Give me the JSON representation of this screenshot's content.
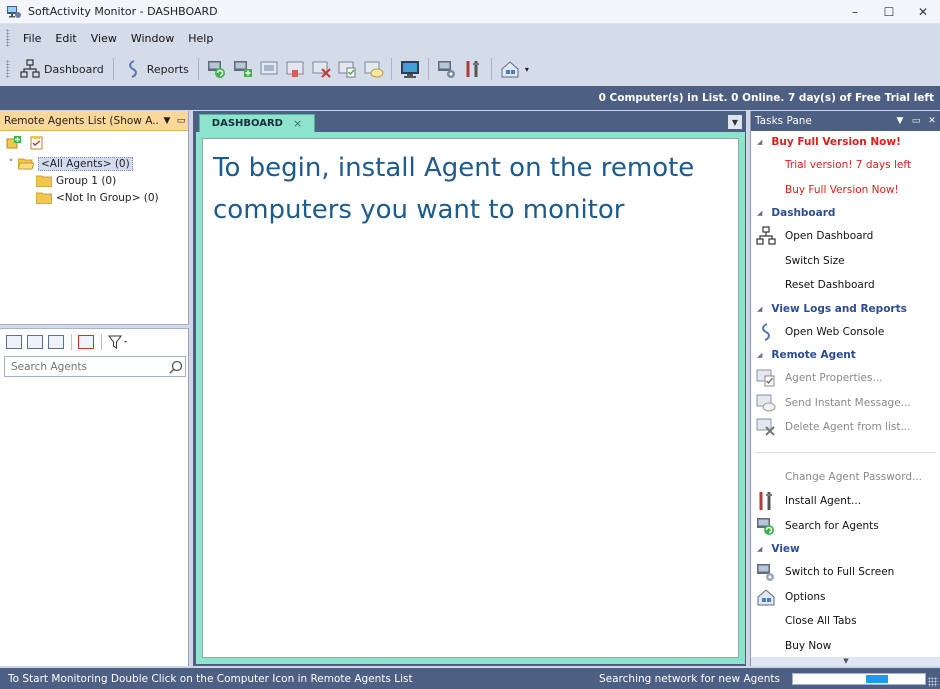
{
  "window": {
    "title": "SoftActivity Monitor - DASHBOARD",
    "controls": [
      "–",
      "☐",
      "✕"
    ]
  },
  "menu": [
    "File",
    "Edit",
    "View",
    "Window",
    "Help"
  ],
  "toolbar": {
    "dashboard_label": "Dashboard",
    "reports_label": "Reports"
  },
  "infobar": {
    "text": "0 Computer(s) in List. 0 Online. 7 day(s) of Free Trial left"
  },
  "left_pane": {
    "title": "Remote Agents List (Show A...",
    "tree": [
      {
        "label": "<All Agents> (0)",
        "level": 0,
        "expander": "˅",
        "selected": true
      },
      {
        "label": "Group 1 (0)",
        "level": 1,
        "expander": "",
        "selected": false
      },
      {
        "label": "<Not In Group> (0)",
        "level": 1,
        "expander": "",
        "selected": false
      }
    ],
    "search_placeholder": "Search Agents"
  },
  "document": {
    "tab_label": "DASHBOARD",
    "tab_close": "×",
    "message": "To begin, install Agent on the remote computers you want to monitor"
  },
  "tasks_pane": {
    "title": "Tasks Pane",
    "sections": [
      {
        "title": "Buy Full Version Now!",
        "style": "red",
        "items": [
          {
            "label": "Trial version! 7 days left",
            "icon": "",
            "style": "red"
          },
          {
            "label": "Buy Full Version Now!",
            "icon": "",
            "style": "red"
          }
        ]
      },
      {
        "title": "Dashboard",
        "style": "",
        "items": [
          {
            "label": "Open Dashboard",
            "icon": "network-icon",
            "style": ""
          },
          {
            "label": "Switch Size",
            "icon": "",
            "style": ""
          },
          {
            "label": "Reset Dashboard",
            "icon": "",
            "style": ""
          }
        ]
      },
      {
        "title": "View Logs and Reports",
        "style": "",
        "items": [
          {
            "label": "Open Web Console",
            "icon": "web-console-icon",
            "style": ""
          }
        ]
      },
      {
        "title": "Remote Agent",
        "style": "",
        "items": [
          {
            "label": "Agent Properties...",
            "icon": "agent-properties-icon",
            "style": "dis"
          },
          {
            "label": "Send Instant Message...",
            "icon": "message-icon",
            "style": "dis"
          },
          {
            "label": "Delete Agent from list...",
            "icon": "delete-agent-icon",
            "style": "dis"
          },
          {
            "label": "---",
            "icon": "",
            "style": "sep"
          },
          {
            "label": "Change Agent Password...",
            "icon": "",
            "style": "dis"
          },
          {
            "label": "Install Agent...",
            "icon": "install-agent-icon",
            "style": ""
          },
          {
            "label": "Search for Agents",
            "icon": "search-agents-icon",
            "style": ""
          }
        ]
      },
      {
        "title": "View",
        "style": "",
        "items": [
          {
            "label": "Switch to Full Screen",
            "icon": "full-screen-icon",
            "style": ""
          },
          {
            "label": "Options",
            "icon": "options-icon",
            "style": ""
          },
          {
            "label": "Close All Tabs",
            "icon": "",
            "style": ""
          },
          {
            "label": "Buy Now",
            "icon": "",
            "style": ""
          }
        ]
      }
    ]
  },
  "status": {
    "left": "To Start Monitoring Double Click on the Computer Icon in Remote Agents List",
    "right": "Searching network for new Agents",
    "progress_segments": [
      [
        0.55,
        0.72
      ]
    ]
  }
}
